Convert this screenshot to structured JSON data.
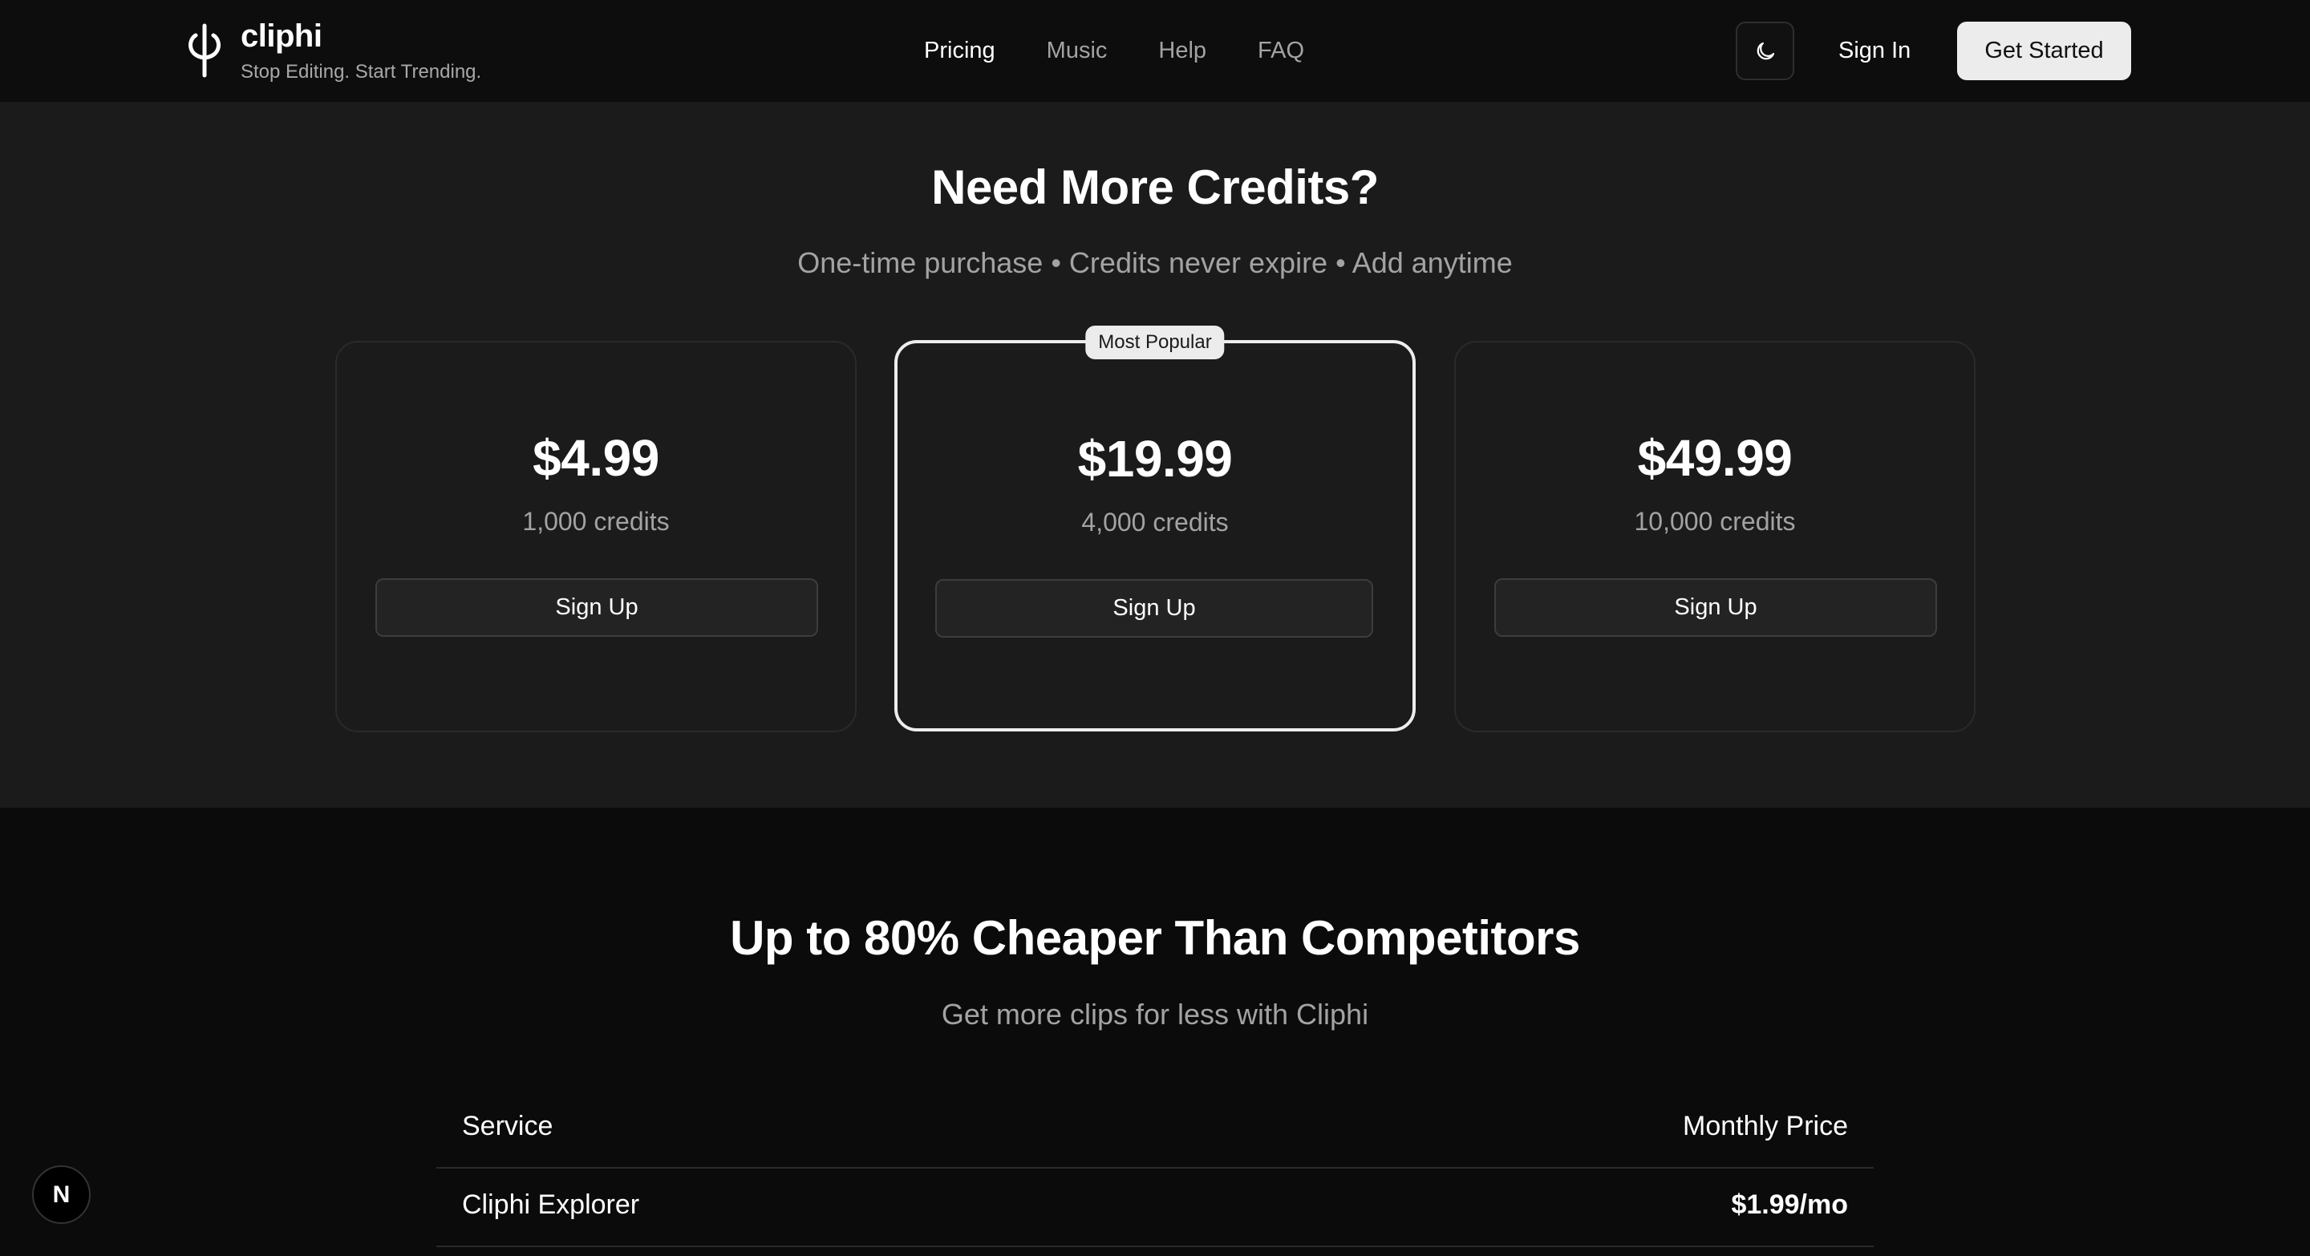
{
  "brand": {
    "name": "cliphi",
    "tagline": "Stop Editing. Start Trending."
  },
  "nav": {
    "links": [
      {
        "label": "Pricing",
        "active": true
      },
      {
        "label": "Music",
        "active": false
      },
      {
        "label": "Help",
        "active": false
      },
      {
        "label": "FAQ",
        "active": false
      }
    ],
    "theme_icon": "moon-icon",
    "sign_in": "Sign In",
    "get_started": "Get Started"
  },
  "credits": {
    "title": "Need More Credits?",
    "subtitle": "One-time purchase • Credits never expire • Add anytime",
    "plans": [
      {
        "price": "$4.99",
        "credits": "1,000 credits",
        "button": "Sign Up",
        "badge": ""
      },
      {
        "price": "$19.99",
        "credits": "4,000 credits",
        "button": "Sign Up",
        "badge": "Most Popular"
      },
      {
        "price": "$49.99",
        "credits": "10,000 credits",
        "button": "Sign Up",
        "badge": ""
      }
    ]
  },
  "compare": {
    "title": "Up to 80% Cheaper Than Competitors",
    "subtitle": "Get more clips for less with Cliphi",
    "headers": {
      "service": "Service",
      "price": "Monthly Price"
    },
    "rows": [
      {
        "service": "Cliphi Explorer",
        "price": "$1.99/mo"
      }
    ]
  },
  "dev_badge": "N",
  "colors": {
    "nav_bg": "#0d0d0d",
    "section_bg": "#1b1b1b",
    "page_bg": "#0b0b0b",
    "accent_button": "#ececec",
    "muted_text": "#a3a3a3"
  }
}
